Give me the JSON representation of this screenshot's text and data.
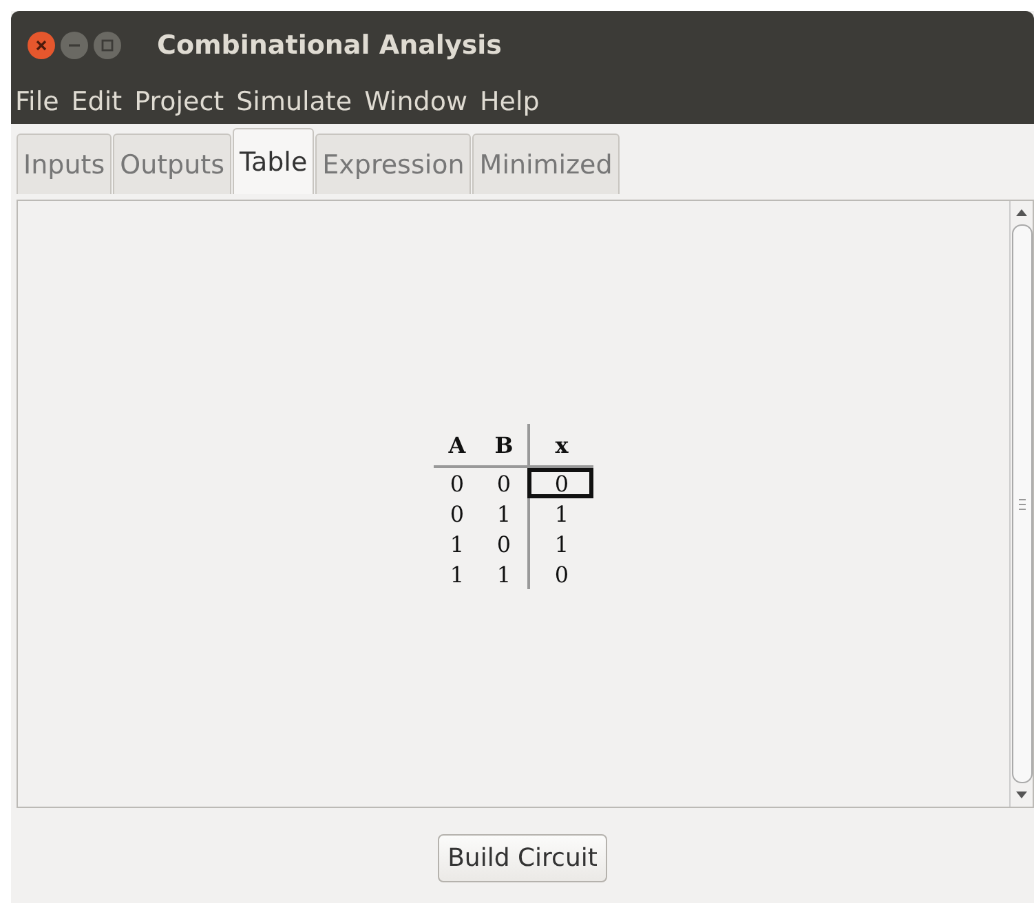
{
  "window": {
    "title": "Combinational Analysis"
  },
  "menu": [
    "File",
    "Edit",
    "Project",
    "Simulate",
    "Window",
    "Help"
  ],
  "tabs": [
    {
      "label": "Inputs",
      "selected": false
    },
    {
      "label": "Outputs",
      "selected": false
    },
    {
      "label": "Table",
      "selected": true
    },
    {
      "label": "Expression",
      "selected": false
    },
    {
      "label": "Minimized",
      "selected": false
    }
  ],
  "table": {
    "input_columns": [
      "A",
      "B"
    ],
    "output_columns": [
      "x"
    ],
    "rows": [
      {
        "inputs": [
          "0",
          "0"
        ],
        "outputs": [
          {
            "value": "0",
            "selected": true
          }
        ]
      },
      {
        "inputs": [
          "0",
          "1"
        ],
        "outputs": [
          {
            "value": "1",
            "selected": false
          }
        ]
      },
      {
        "inputs": [
          "1",
          "0"
        ],
        "outputs": [
          {
            "value": "1",
            "selected": false
          }
        ]
      },
      {
        "inputs": [
          "1",
          "1"
        ],
        "outputs": [
          {
            "value": "0",
            "selected": false
          }
        ]
      }
    ]
  },
  "buttons": [
    "Build Circuit"
  ]
}
